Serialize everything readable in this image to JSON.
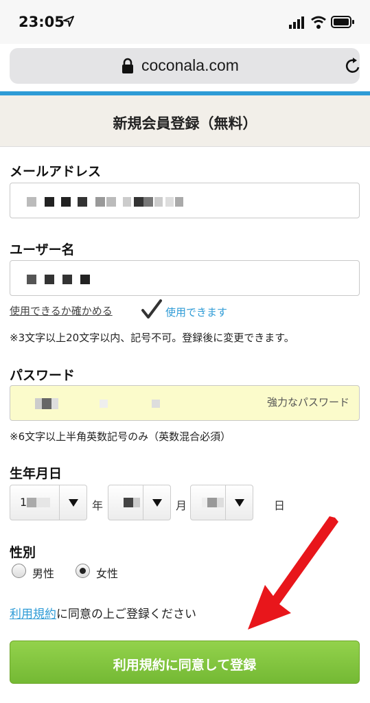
{
  "status_bar": {
    "time": "23:05"
  },
  "browser": {
    "url": "coconala.com"
  },
  "page": {
    "title": "新規会員登録（無料）"
  },
  "form": {
    "email": {
      "label": "メールアドレス"
    },
    "username": {
      "label": "ユーザー名",
      "check_link": "使用できるか確かめる",
      "availability": "使用できます",
      "note": "※3文字以上20文字以内、記号不可。登録後に変更できます。"
    },
    "password": {
      "label": "パスワード",
      "strength": "強力なパスワード",
      "note": "※6文字以上半角英数記号のみ（英数混合必須）"
    },
    "birthdate": {
      "label": "生年月日",
      "year_unit": "年",
      "month_unit": "月",
      "day_unit": "日",
      "year_value": "1"
    },
    "gender": {
      "label": "性別",
      "options": [
        "男性",
        "女性"
      ],
      "selected": "女性"
    },
    "terms": {
      "link": "利用規約",
      "text": "に同意の上ご登録ください"
    },
    "submit_label": "利用規約に同意して登録"
  },
  "colors": {
    "accent_blue": "#2e9bd6",
    "submit_green": "#7dc13a",
    "arrow_red": "#e8161b"
  }
}
